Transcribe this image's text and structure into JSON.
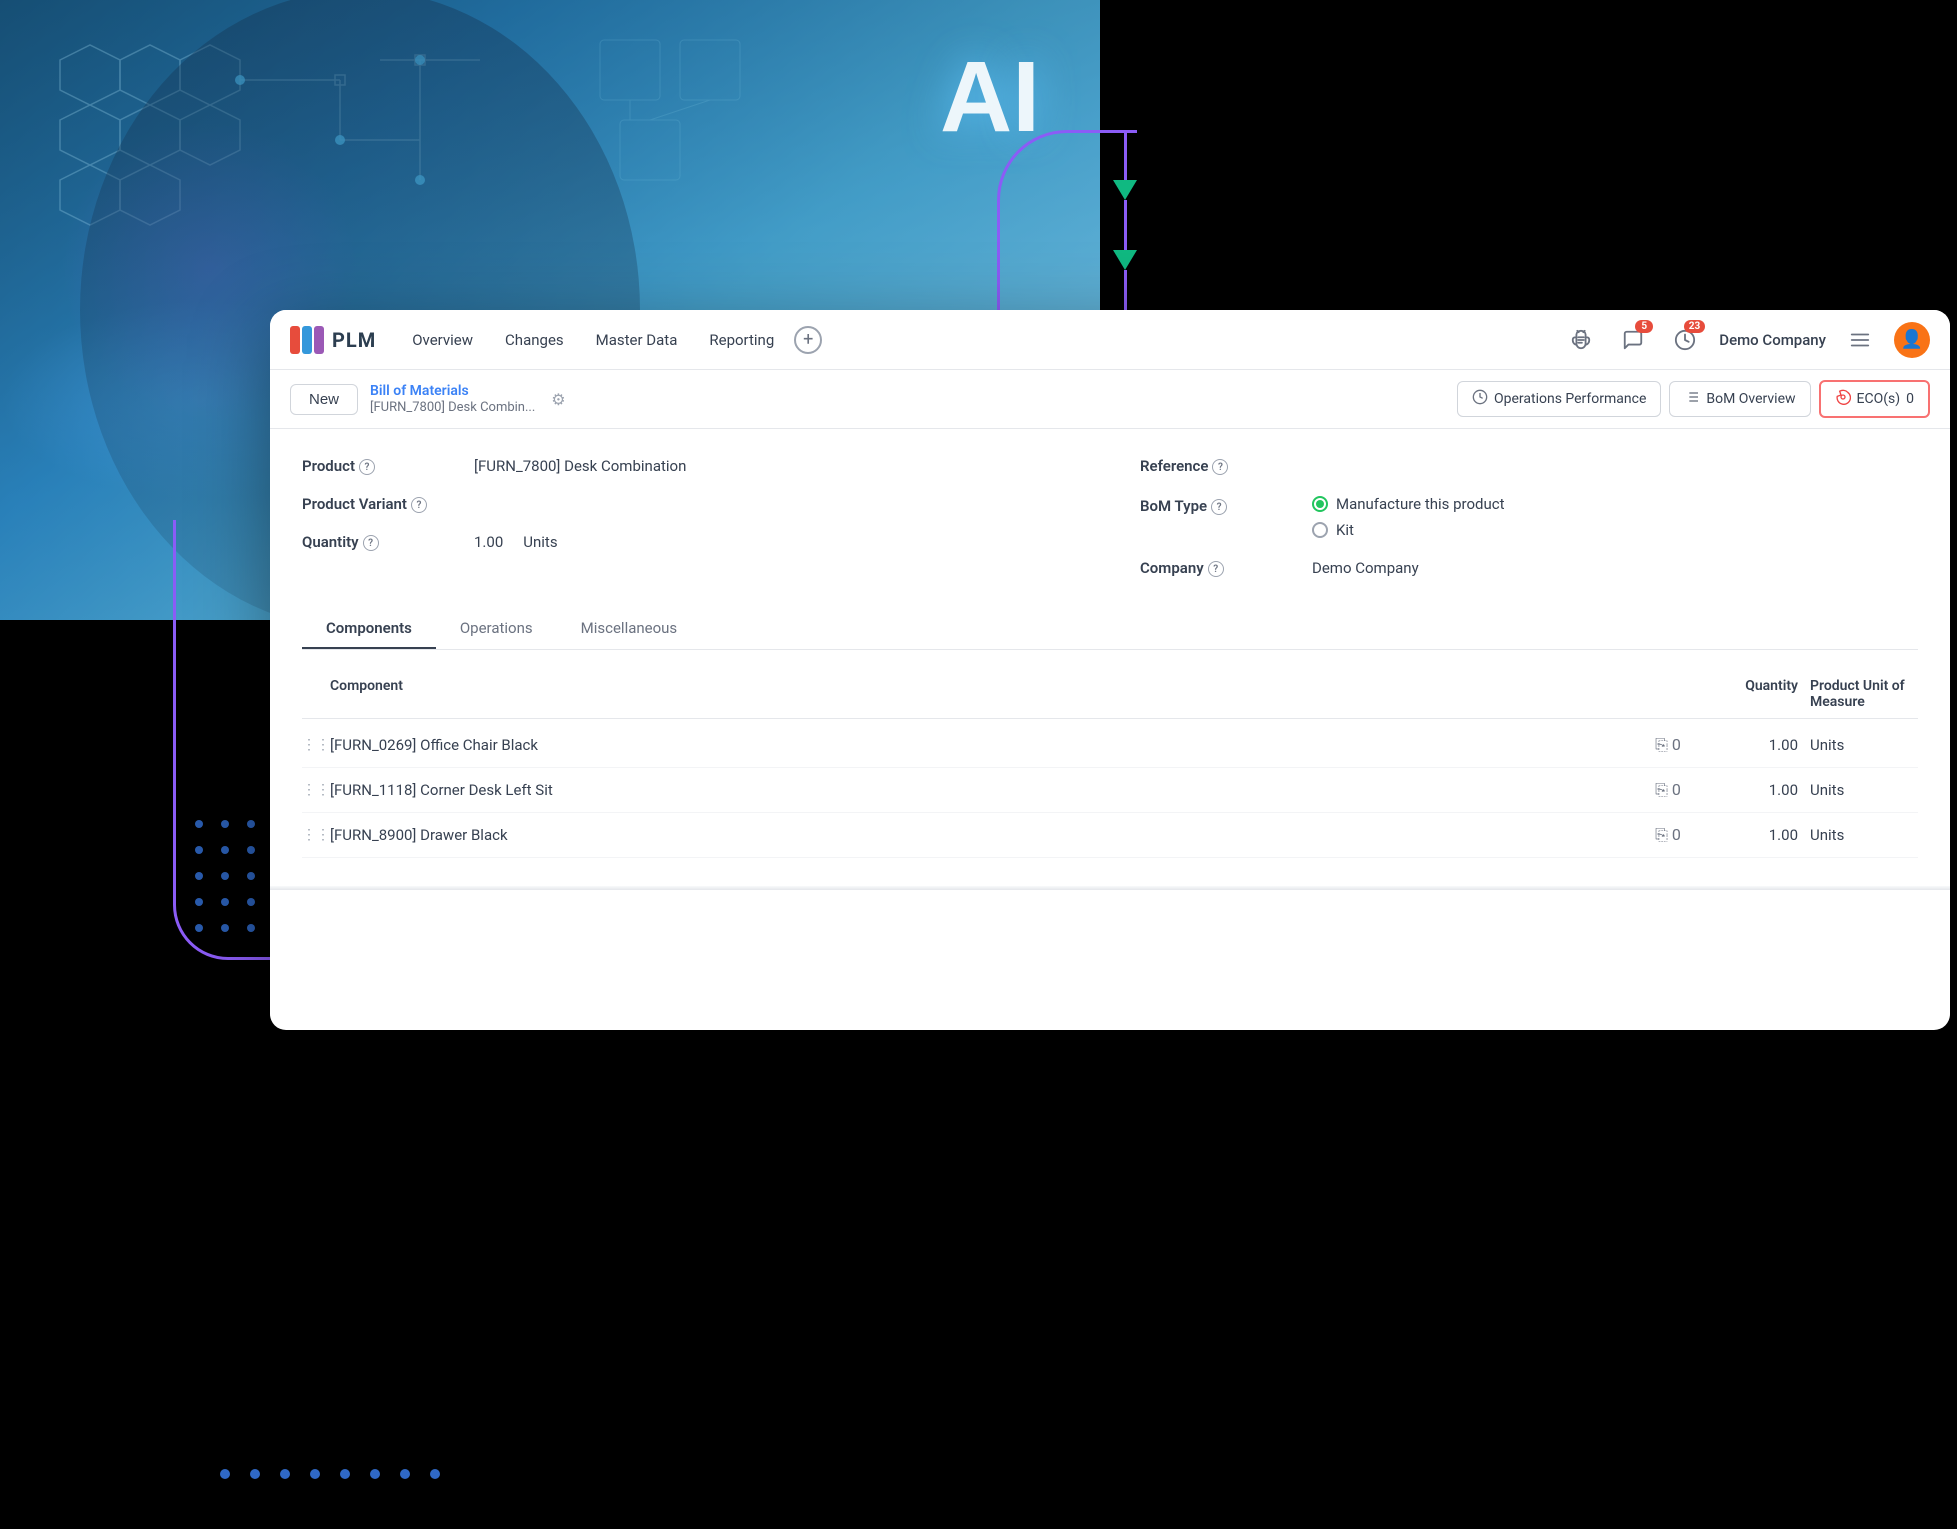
{
  "background": {
    "ai_text": "AI"
  },
  "navbar": {
    "logo_text": "PLM",
    "links": [
      {
        "label": "Overview",
        "id": "overview"
      },
      {
        "label": "Changes",
        "id": "changes"
      },
      {
        "label": "Master Data",
        "id": "master-data"
      },
      {
        "label": "Reporting",
        "id": "reporting"
      }
    ],
    "plus_label": "+",
    "bug_badge": "",
    "chat_badge": "5",
    "clock_badge": "23",
    "company_name": "Demo Company"
  },
  "action_bar": {
    "new_label": "New",
    "breadcrumb_title": "Bill of Materials",
    "breadcrumb_subtitle": "[FURN_7800] Desk Combin...",
    "btn_ops_perf": "Operations Performance",
    "btn_bom_overview": "BoM Overview",
    "btn_eco": "ECO(s)",
    "eco_count": "0"
  },
  "form": {
    "product_label": "Product",
    "product_value": "[FURN_7800] Desk Combination",
    "product_variant_label": "Product Variant",
    "product_variant_value": "",
    "quantity_label": "Quantity",
    "quantity_value": "1.00",
    "quantity_unit": "Units",
    "reference_label": "Reference",
    "reference_value": "",
    "bom_type_label": "BoM Type",
    "bom_type_option1": "Manufacture this product",
    "bom_type_option2": "Kit",
    "company_label": "Company",
    "company_value": "Demo Company"
  },
  "tabs": [
    {
      "label": "Components",
      "active": true
    },
    {
      "label": "Operations",
      "active": false
    },
    {
      "label": "Miscellaneous",
      "active": false
    }
  ],
  "table": {
    "col_component": "Component",
    "col_quantity": "Quantity",
    "col_uom": "Product Unit of Measure",
    "rows": [
      {
        "component": "[FURN_0269] Office Chair Black",
        "copy_count": "0",
        "quantity": "1.00",
        "uom": "Units"
      },
      {
        "component": "[FURN_1118] Corner Desk Left Sit",
        "copy_count": "0",
        "quantity": "1.00",
        "uom": "Units"
      },
      {
        "component": "[FURN_8900] Drawer Black",
        "copy_count": "0",
        "quantity": "1.00",
        "uom": "Units"
      }
    ]
  }
}
